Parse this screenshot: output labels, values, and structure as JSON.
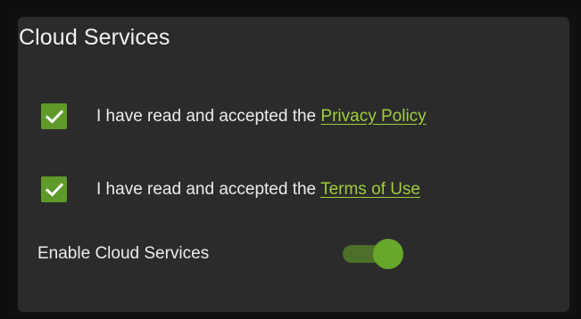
{
  "panel": {
    "title": "Cloud Services"
  },
  "privacy": {
    "checked": true,
    "label_prefix": "I have read and accepted the ",
    "link_text": "Privacy Policy"
  },
  "terms": {
    "checked": true,
    "label_prefix": "I have read and accepted the ",
    "link_text": "Terms of Use"
  },
  "cloud_toggle": {
    "label": "Enable Cloud Services",
    "on": true
  },
  "colors": {
    "card_background": "#2b2b2b",
    "accent_green": "#5f9a2b",
    "link_green": "#9fcf3c",
    "toggle_track": "#4c6f2a",
    "toggle_thumb": "#67a72b"
  },
  "icons": {
    "checkbox": "checkmark-icon"
  }
}
